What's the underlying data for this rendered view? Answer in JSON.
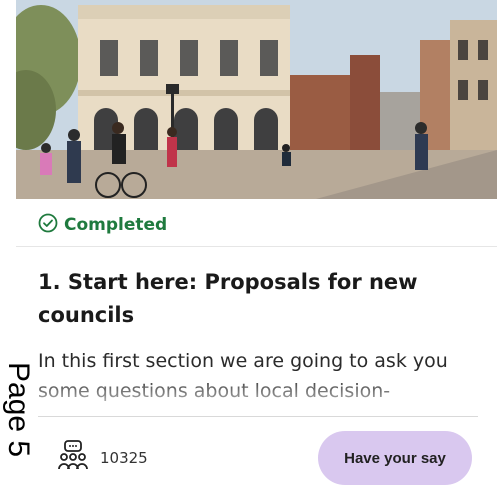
{
  "card": {
    "status": "Completed",
    "title": "1. Start here: Proposals for new councils",
    "description": "In this first section we are going to ask you some questions about local decision-",
    "participants_count": "10325",
    "cta_label": "Have your say"
  },
  "page_stamp": "Page 5",
  "colors": {
    "status_green": "#1f7a3e",
    "cta_background": "#d9c8ef"
  },
  "icons": [
    "check-circle-icon",
    "people-group-icon"
  ]
}
